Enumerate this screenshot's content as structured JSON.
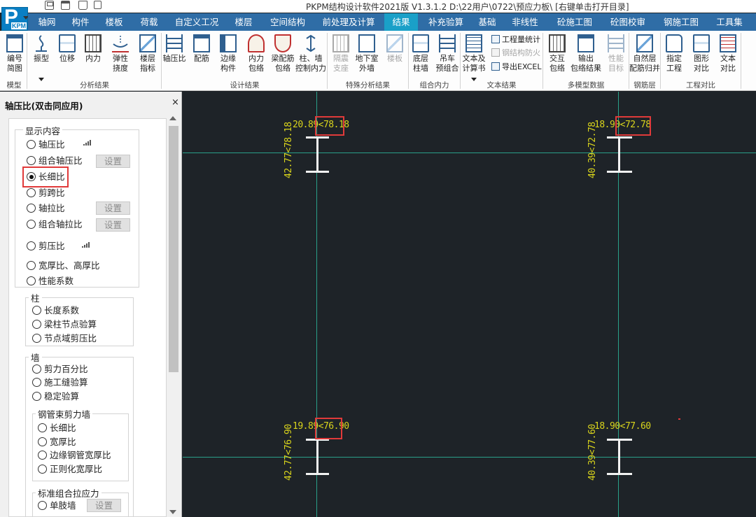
{
  "app": {
    "title": "PKPM结构设计软件2021版 V1.3.1.2 D:\\22用户\\0722\\预应力板\\ [右键单击打开目录]",
    "logo_text": "PKPM"
  },
  "quick_access": [
    "save-icon",
    "printer-icon",
    "open-icon"
  ],
  "menu": {
    "tabs": [
      "轴网",
      "构件",
      "楼板",
      "荷载",
      "自定义工况",
      "楼层",
      "空间结构",
      "前处理及计算",
      "结果",
      "补充验算",
      "基础",
      "非线性",
      "砼施工图",
      "砼图校审",
      "钢施工图",
      "工具集"
    ],
    "active": "结果"
  },
  "ribbon": {
    "buttons": [
      {
        "label": "编号\n简图",
        "icon": "model-number-icon"
      },
      {
        "label": "振型",
        "icon": "vibration-mode-icon"
      },
      {
        "label": "位移",
        "icon": "displacement-icon"
      },
      {
        "label": "内力",
        "icon": "internal-force-icon"
      },
      {
        "label": "弹性\n挠度",
        "icon": "elastic-deflection-icon"
      },
      {
        "label": "楼层\n指标",
        "icon": "floor-index-icon"
      },
      {
        "label": "轴压比",
        "icon": "axial-compression-ratio-icon"
      },
      {
        "label": "配筋",
        "icon": "reinforcement-icon"
      },
      {
        "label": "边缘\n构件",
        "icon": "edge-member-icon"
      },
      {
        "label": "内力\n包络",
        "icon": "force-envelope-icon"
      },
      {
        "label": "梁配筋\n包络",
        "icon": "beam-reinforcement-envelope-icon"
      },
      {
        "label": "柱、墙\n控制内力",
        "icon": "column-wall-control-force-icon"
      },
      {
        "label": "隔震\n支座",
        "icon": "isolation-bearing-icon",
        "disabled": true
      },
      {
        "label": "地下室\n外墙",
        "icon": "basement-wall-icon"
      },
      {
        "label": "楼板",
        "icon": "slab-icon",
        "disabled": true
      },
      {
        "label": "底层\n柱墙",
        "icon": "base-column-wall-icon"
      },
      {
        "label": "吊车\n预组合",
        "icon": "crane-precombination-icon"
      },
      {
        "label": "文本及\n计算书",
        "icon": "text-calcbook-icon"
      },
      {
        "label": "交互\n包络",
        "icon": "interactive-envelope-icon"
      },
      {
        "label": "输出\n包络结果",
        "icon": "output-envelope-icon"
      },
      {
        "label": "性能\n目标",
        "icon": "performance-target-icon",
        "disabled": true
      },
      {
        "label": "自然层\n配筋归并",
        "icon": "natural-floor-merge-icon"
      },
      {
        "label": "指定\n工程",
        "icon": "specify-project-icon"
      },
      {
        "label": "图形\n对比",
        "icon": "graphic-compare-icon"
      },
      {
        "label": "文本\n对比",
        "icon": "text-compare-icon"
      }
    ],
    "small_buttons": [
      {
        "label": "工程量统计",
        "disabled": false
      },
      {
        "label": "钢结构防火",
        "disabled": true
      },
      {
        "label": "导出EXCEL",
        "disabled": false
      }
    ],
    "groups": [
      "模型",
      "分析结果",
      "设计结果",
      "特殊分析结果",
      "组合内力",
      "文本结果",
      "多模型数据",
      "钢筋层",
      "工程对比"
    ]
  },
  "panel": {
    "title": "轴压比(双击同应用)",
    "close": "×",
    "display_group": "显示内容",
    "display_items": [
      {
        "label": "轴压比",
        "selected": false,
        "signal": true
      },
      {
        "label": "组合轴压比",
        "selected": false,
        "button": "设置"
      },
      {
        "label": "长细比",
        "selected": true
      },
      {
        "label": "剪跨比",
        "selected": false
      },
      {
        "label": "轴拉比",
        "selected": false,
        "button": "设置"
      },
      {
        "label": "组合轴拉比",
        "selected": false,
        "button": "设置"
      },
      {
        "label": "剪压比",
        "selected": false,
        "signal": true
      },
      {
        "label": "宽厚比、高厚比",
        "selected": false
      },
      {
        "label": "性能系数",
        "selected": false
      }
    ],
    "column_group": "柱",
    "column_items": [
      "长度系数",
      "梁柱节点验算",
      "节点域剪压比"
    ],
    "wall_group": "墙",
    "wall_items": [
      "剪力百分比",
      "施工缝验算",
      "稳定验算"
    ],
    "steel_tube_group": "钢管束剪力墙",
    "steel_tube_items": [
      "长细比",
      "宽厚比",
      "边缘钢管宽厚比",
      "正则化宽厚比"
    ],
    "tension_group": "标准组合拉应力",
    "tension_items": [
      {
        "label": "单肢墙",
        "button": "设置"
      }
    ]
  },
  "canvas": {
    "members": [
      {
        "top_label_a": "20.89",
        "top_label_b": "78.18",
        "side_label": "42.77<78.18",
        "highlight": true
      },
      {
        "top_label_a": "18.90",
        "top_label_b": "72.78",
        "side_label": "40.39<72.78",
        "highlight": true
      },
      {
        "top_label_a": "19.89",
        "top_label_b": "76.90",
        "side_label": "42.77<76.90",
        "highlight": true
      },
      {
        "top_label_a": "18.90",
        "top_label_b": "77.60",
        "side_label": "40.39<77.60",
        "highlight": true
      }
    ],
    "colors": {
      "background": "#1e2328",
      "grid": "#2aa08a",
      "label": "#d9d41c",
      "member": "#f2f2f2",
      "highlight": "#e03a3a"
    }
  }
}
